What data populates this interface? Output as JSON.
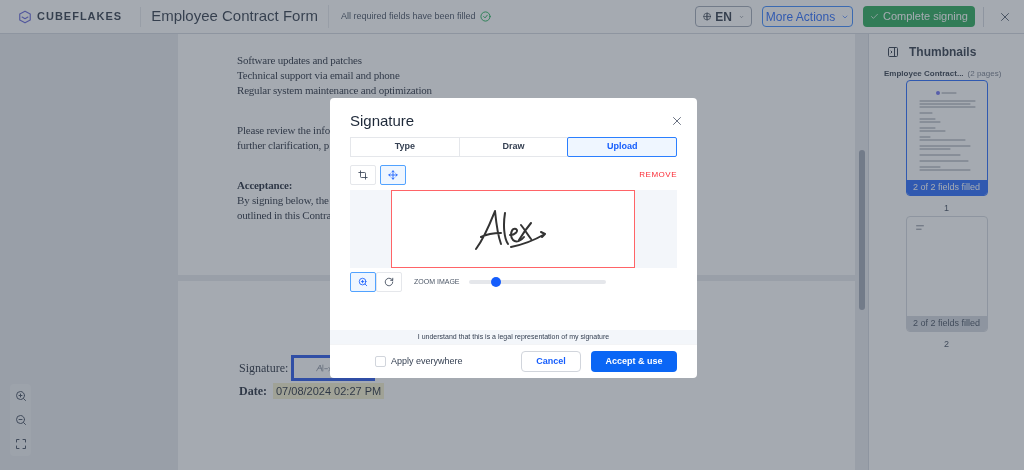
{
  "header": {
    "logo": "CUBEFLAKES",
    "title": "Employee Contract Form",
    "status": "All required fields have been filled",
    "language": "EN",
    "more_actions": "More Actions",
    "complete": "Complete signing"
  },
  "document": {
    "page1": [
      {
        "kind": "text",
        "text": "Software updates and patches"
      },
      {
        "kind": "text",
        "text": "Technical support via email and phone"
      },
      {
        "kind": "text",
        "text": "Regular system maintenance and optimization"
      },
      {
        "kind": "gap"
      },
      {
        "kind": "text",
        "text": "Please review the info"
      },
      {
        "kind": "text",
        "text": "further clarification, p"
      },
      {
        "kind": "gap"
      },
      {
        "kind": "heading",
        "text": "Acceptance:"
      },
      {
        "kind": "text",
        "text": "By signing below, the"
      },
      {
        "kind": "text",
        "text": "outlined in this Contra"
      }
    ],
    "page2": {
      "signature_label": "Signature:",
      "date_label": "Date:",
      "date_value": "07/08/2024 02:27 PM"
    }
  },
  "thumbnails": {
    "title": "Thumbnails",
    "doc_name": "Employee Contract...",
    "page_count": "(2 pages)",
    "pages": [
      {
        "status": "2 of 2 fields filled",
        "number": "1",
        "selected": true
      },
      {
        "status": "2 of 2 fields filled",
        "number": "2",
        "selected": false
      }
    ]
  },
  "dialog": {
    "title": "Signature",
    "tabs": [
      {
        "label": "Type",
        "selected": false
      },
      {
        "label": "Draw",
        "selected": false
      },
      {
        "label": "Upload",
        "selected": true
      }
    ],
    "tools": [
      {
        "kind": "crop",
        "selected": false
      },
      {
        "kind": "move",
        "selected": true
      }
    ],
    "remove": "REMOVE",
    "zoom_tools": [
      {
        "kind": "zoom-in",
        "selected": true
      },
      {
        "kind": "rotate",
        "selected": false
      }
    ],
    "zoom_label": "ZOOM IMAGE",
    "zoom": {
      "level": 0.2
    },
    "notice": "I understand that this is a legal representation of my signature",
    "apply_everywhere": {
      "label": "Apply everywhere",
      "checked": false
    },
    "cancel": "Cancel",
    "accept": "Accept & use"
  }
}
